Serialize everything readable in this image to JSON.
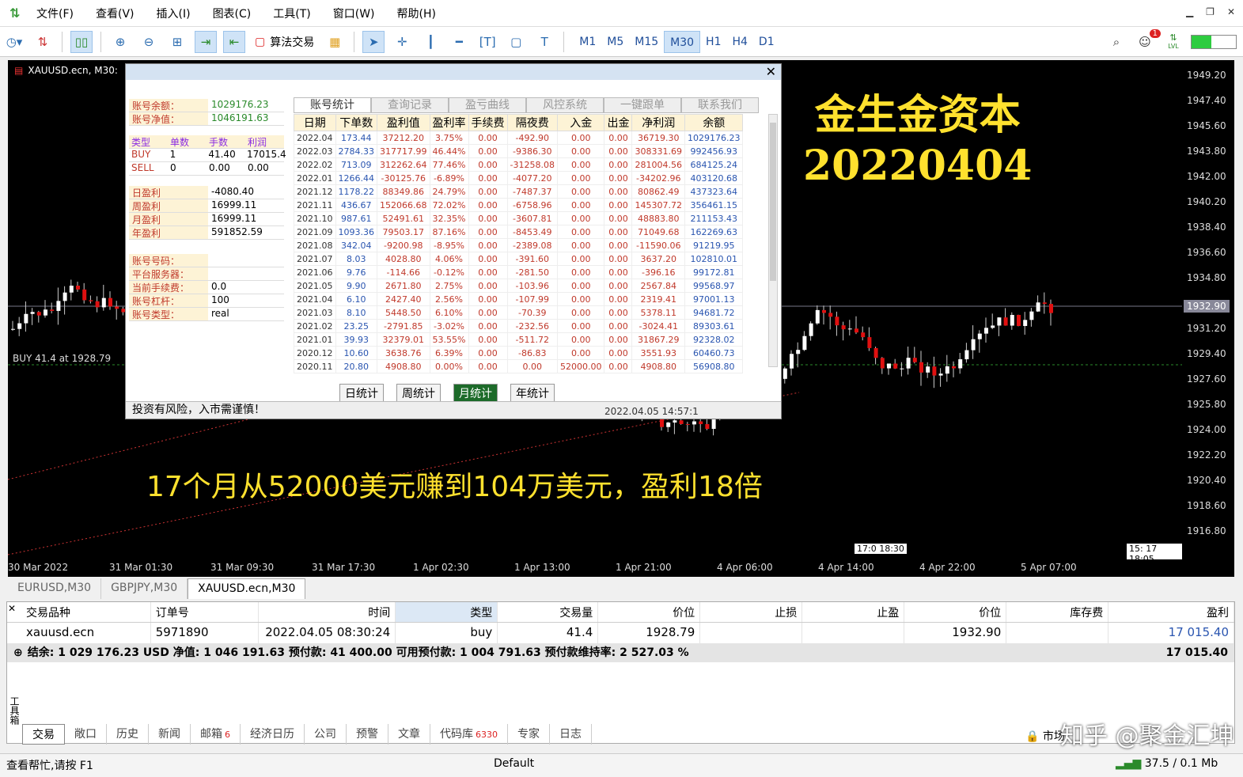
{
  "menu": {
    "items": [
      "文件(F)",
      "查看(V)",
      "插入(I)",
      "图表(C)",
      "工具(T)",
      "窗口(W)",
      "帮助(H)"
    ]
  },
  "toolbar": {
    "algo_label": "算法交易",
    "timeframes": [
      "M1",
      "M5",
      "M15",
      "M30",
      "H1",
      "H4",
      "D1"
    ],
    "active_tf": "M30",
    "notif_count": "1",
    "lvl_label": "LVL"
  },
  "chart": {
    "title": "XAUUSD.ecn, M30:",
    "buy_line": "BUY 41.4 at 1928.79",
    "banner_title": "金生金资本",
    "banner_date": "20220404",
    "caption": "17个月从52000美元赚到104万美元，盈利18倍",
    "price_tag": "1932.90",
    "y_ticks": [
      "1949.20",
      "1947.40",
      "1945.60",
      "1943.80",
      "1942.00",
      "1940.20",
      "1938.40",
      "1936.60",
      "1934.80",
      "1931.20",
      "1929.40",
      "1927.60",
      "1925.80",
      "1924.00",
      "1922.20",
      "1920.40",
      "1918.60",
      "1916.80"
    ],
    "x_ticks": [
      "30 Mar 2022",
      "31 Mar 01:30",
      "31 Mar 09:30",
      "31 Mar 17:30",
      "1 Apr 02:30",
      "1 Apr 13:00",
      "1 Apr 21:00",
      "4 Apr 06:00",
      "4 Apr 14:00",
      "4 Apr 22:00",
      "5 Apr 07:00"
    ],
    "time_label1": "17:0 18:30",
    "time_label2": "15: 17 18:05"
  },
  "panel": {
    "balance_label": "账号余额：",
    "balance": "1029176.23",
    "equity_label": "账号净值：",
    "equity": "1046191.63",
    "pos_headers": [
      "类型",
      "单数",
      "手数",
      "利润"
    ],
    "pos_rows": [
      [
        "BUY",
        "1",
        "41.40",
        "17015.4"
      ],
      [
        "SELL",
        "0",
        "0.00",
        "0.00"
      ]
    ],
    "profits": [
      [
        "日盈利",
        "-4080.40"
      ],
      [
        "周盈利",
        "16999.11"
      ],
      [
        "月盈利",
        "16999.11"
      ],
      [
        "年盈利",
        "591852.59"
      ]
    ],
    "acct": [
      [
        "账号号码：",
        ""
      ],
      [
        "平台服务器：",
        ""
      ],
      [
        "当前手续费：",
        "0.0"
      ],
      [
        "账号杠杆：",
        "100"
      ],
      [
        "账号类型：",
        "real"
      ]
    ],
    "tabs": [
      "账号统计",
      "查询记录",
      "盈亏曲线",
      "风控系统",
      "一键跟单",
      "联系我们"
    ],
    "table_headers": [
      "日期",
      "下单数",
      "盈利值",
      "盈利率",
      "手续费",
      "隔夜费",
      "入金",
      "出金",
      "净利润",
      "余额"
    ],
    "rows": [
      [
        "2022.04",
        "173.44",
        "37212.20",
        "3.75%",
        "0.00",
        "-492.90",
        "0.00",
        "0.00",
        "36719.30",
        "1029176.23"
      ],
      [
        "2022.03",
        "2784.33",
        "317717.99",
        "46.44%",
        "0.00",
        "-9386.30",
        "0.00",
        "0.00",
        "308331.69",
        "992456.93"
      ],
      [
        "2022.02",
        "713.09",
        "312262.64",
        "77.46%",
        "0.00",
        "-31258.08",
        "0.00",
        "0.00",
        "281004.56",
        "684125.24"
      ],
      [
        "2022.01",
        "1266.44",
        "-30125.76",
        "-6.89%",
        "0.00",
        "-4077.20",
        "0.00",
        "0.00",
        "-34202.96",
        "403120.68"
      ],
      [
        "2021.12",
        "1178.22",
        "88349.86",
        "24.79%",
        "0.00",
        "-7487.37",
        "0.00",
        "0.00",
        "80862.49",
        "437323.64"
      ],
      [
        "2021.11",
        "436.67",
        "152066.68",
        "72.02%",
        "0.00",
        "-6758.96",
        "0.00",
        "0.00",
        "145307.72",
        "356461.15"
      ],
      [
        "2021.10",
        "987.61",
        "52491.61",
        "32.35%",
        "0.00",
        "-3607.81",
        "0.00",
        "0.00",
        "48883.80",
        "211153.43"
      ],
      [
        "2021.09",
        "1093.36",
        "79503.17",
        "87.16%",
        "0.00",
        "-8453.49",
        "0.00",
        "0.00",
        "71049.68",
        "162269.63"
      ],
      [
        "2021.08",
        "342.04",
        "-9200.98",
        "-8.95%",
        "0.00",
        "-2389.08",
        "0.00",
        "0.00",
        "-11590.06",
        "91219.95"
      ],
      [
        "2021.07",
        "8.03",
        "4028.80",
        "4.06%",
        "0.00",
        "-391.60",
        "0.00",
        "0.00",
        "3637.20",
        "102810.01"
      ],
      [
        "2021.06",
        "9.76",
        "-114.66",
        "-0.12%",
        "0.00",
        "-281.50",
        "0.00",
        "0.00",
        "-396.16",
        "99172.81"
      ],
      [
        "2021.05",
        "9.90",
        "2671.80",
        "2.75%",
        "0.00",
        "-103.96",
        "0.00",
        "0.00",
        "2567.84",
        "99568.97"
      ],
      [
        "2021.04",
        "6.10",
        "2427.40",
        "2.56%",
        "0.00",
        "-107.99",
        "0.00",
        "0.00",
        "2319.41",
        "97001.13"
      ],
      [
        "2021.03",
        "8.10",
        "5448.50",
        "6.10%",
        "0.00",
        "-70.39",
        "0.00",
        "0.00",
        "5378.11",
        "94681.72"
      ],
      [
        "2021.02",
        "23.25",
        "-2791.85",
        "-3.02%",
        "0.00",
        "-232.56",
        "0.00",
        "0.00",
        "-3024.41",
        "89303.61"
      ],
      [
        "2021.01",
        "39.93",
        "32379.01",
        "53.55%",
        "0.00",
        "-511.72",
        "0.00",
        "0.00",
        "31867.29",
        "92328.02"
      ],
      [
        "2020.12",
        "10.60",
        "3638.76",
        "6.39%",
        "0.00",
        "-86.83",
        "0.00",
        "0.00",
        "3551.93",
        "60460.73"
      ],
      [
        "2020.11",
        "20.80",
        "4908.80",
        "0.00%",
        "0.00",
        "0.00",
        "52000.00",
        "0.00",
        "4908.80",
        "56908.80"
      ]
    ],
    "stat_buttons": [
      "日统计",
      "周统计",
      "月统计",
      "年统计"
    ],
    "active_stat": "月统计",
    "footer_text": "投资有风险，入市需谨慎！",
    "footer_time": "2022.04.05 14:57:1"
  },
  "symbol_tabs": [
    "EURUSD,M30",
    "GBPJPY,M30",
    "XAUUSD.ecn,M30"
  ],
  "terminal": {
    "headers": [
      "交易品种",
      "订单号",
      "时间",
      "类型",
      "交易量",
      "价位",
      "止损",
      "止盈",
      "价位",
      "库存费",
      "盈利"
    ],
    "row": [
      "xauusd.ecn",
      "5971890",
      "2022.04.05 08:30:24",
      "buy",
      "41.4",
      "1928.79",
      "",
      "",
      "1932.90",
      "",
      "17 015.40"
    ],
    "summary": "结余: 1 029 176.23 USD  净值: 1 046 191.63  预付款: 41 400.00  可用预付款: 1 004 791.63  预付款维持率: 2 527.03 %",
    "summary_total": "17 015.40",
    "side_label": "工具箱",
    "tabs": [
      "交易",
      "敞口",
      "历史",
      "新闻",
      "邮箱",
      "经济日历",
      "公司",
      "预警",
      "文章",
      "代码库",
      "专家",
      "日志"
    ],
    "mail_count": "6",
    "codebase_count": "6330",
    "market_label": "市场",
    "watermark": "知乎 @聚金汇坤"
  },
  "status": {
    "help": "查看帮忙,请按 F1",
    "profile": "Default",
    "conn": "37.5 / 0.1 Mb"
  },
  "colors": {
    "bull": "#1e90ff",
    "bear": "#e01010",
    "caption": "#ffe12e"
  }
}
